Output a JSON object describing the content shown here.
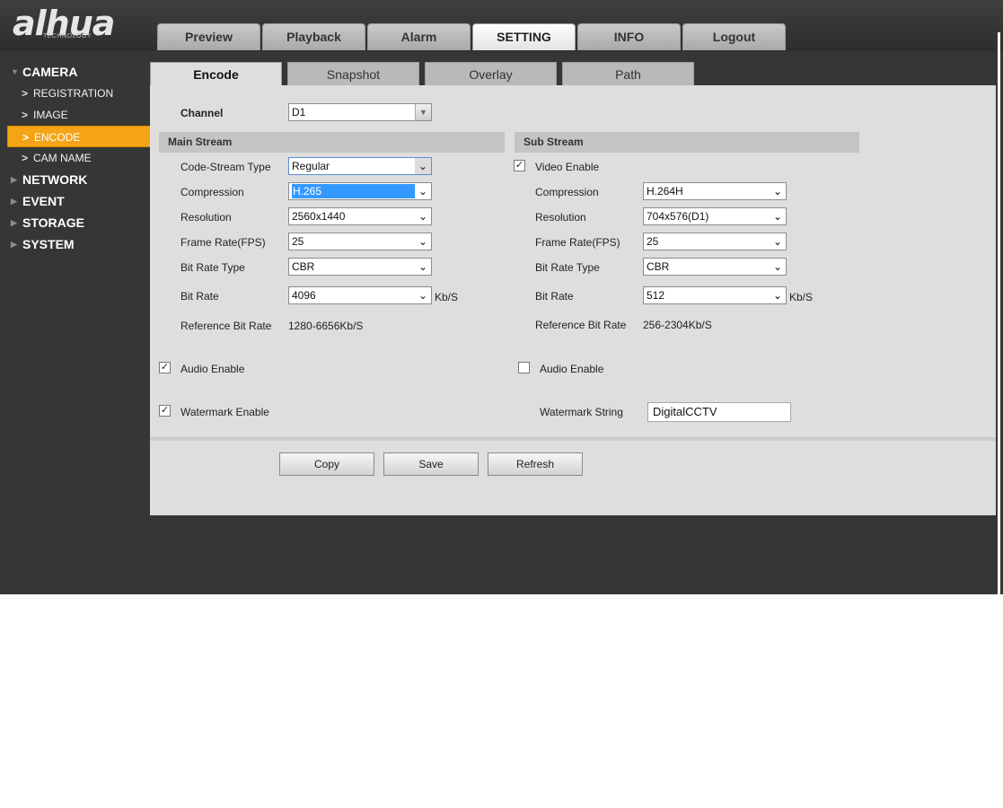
{
  "brand": {
    "name": "alhua",
    "tagline": "TECHNOLOGY"
  },
  "topnav": [
    "Preview",
    "Playback",
    "Alarm",
    "SETTING",
    "INFO",
    "Logout"
  ],
  "sidebar": {
    "camera": "CAMERA",
    "camera_items": [
      "REGISTRATION",
      "IMAGE",
      "ENCODE",
      "CAM NAME"
    ],
    "others": [
      "NETWORK",
      "EVENT",
      "STORAGE",
      "SYSTEM"
    ]
  },
  "subtabs": [
    "Encode",
    "Snapshot",
    "Overlay",
    "Path"
  ],
  "channel": {
    "label": "Channel",
    "value": "D1"
  },
  "main": {
    "title": "Main Stream",
    "code_stream_type": {
      "label": "Code-Stream Type",
      "value": "Regular"
    },
    "compression": {
      "label": "Compression",
      "value": "H.265"
    },
    "resolution": {
      "label": "Resolution",
      "value": "2560x1440"
    },
    "frame_rate": {
      "label": "Frame Rate(FPS)",
      "value": "25"
    },
    "bit_rate_type": {
      "label": "Bit Rate Type",
      "value": "CBR"
    },
    "bit_rate": {
      "label": "Bit Rate",
      "value": "4096",
      "unit": "Kb/S"
    },
    "ref_bit_rate": {
      "label": "Reference Bit Rate",
      "value": "1280-6656Kb/S"
    },
    "audio_enable": {
      "label": "Audio Enable",
      "checked": true
    },
    "watermark_enable": {
      "label": "Watermark Enable",
      "checked": true
    }
  },
  "sub": {
    "title": "Sub Stream",
    "video_enable": {
      "label": "Video Enable",
      "checked": true
    },
    "compression": {
      "label": "Compression",
      "value": "H.264H"
    },
    "resolution": {
      "label": "Resolution",
      "value": "704x576(D1)"
    },
    "frame_rate": {
      "label": "Frame Rate(FPS)",
      "value": "25"
    },
    "bit_rate_type": {
      "label": "Bit Rate Type",
      "value": "CBR"
    },
    "bit_rate": {
      "label": "Bit Rate",
      "value": "512",
      "unit": "Kb/S"
    },
    "ref_bit_rate": {
      "label": "Reference Bit Rate",
      "value": "256-2304Kb/S"
    },
    "audio_enable": {
      "label": "Audio Enable",
      "checked": false
    },
    "watermark_string": {
      "label": "Watermark String",
      "value": "DigitalCCTV"
    }
  },
  "buttons": {
    "copy": "Copy",
    "save": "Save",
    "refresh": "Refresh"
  },
  "icons": {
    "check": "✓",
    "dropdown": "chevron-down-icon",
    "side_chevron": "chevron-right-icon",
    "tree_triangle": "triangle-icon"
  },
  "colors": {
    "active_item": "#f5a417",
    "selection": "#3399ff",
    "background": "#363636",
    "panel": "#dedede"
  }
}
